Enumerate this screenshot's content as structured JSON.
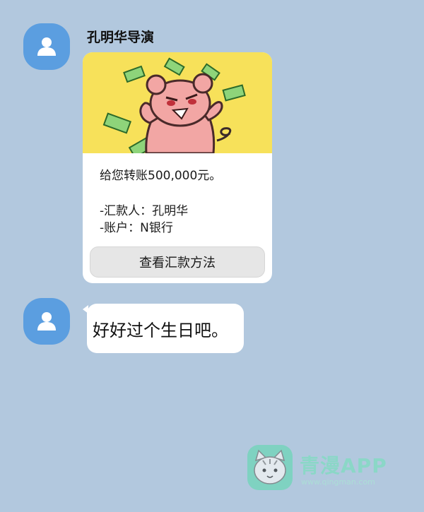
{
  "chat": {
    "sender": "孔明华导演",
    "card": {
      "line1": "给您转账500,000元。",
      "line2": "-汇款人：孔明华",
      "line3": "-账户：N银行",
      "button_label": "查看汇款方法"
    },
    "message": "好好过个生日吧。"
  },
  "watermark": {
    "title": "青漫APP",
    "url": "www.qingman.com"
  },
  "colors": {
    "background": "#b2c8de",
    "avatar": "#5b9ee0",
    "card_banner": "#f7e15a"
  }
}
